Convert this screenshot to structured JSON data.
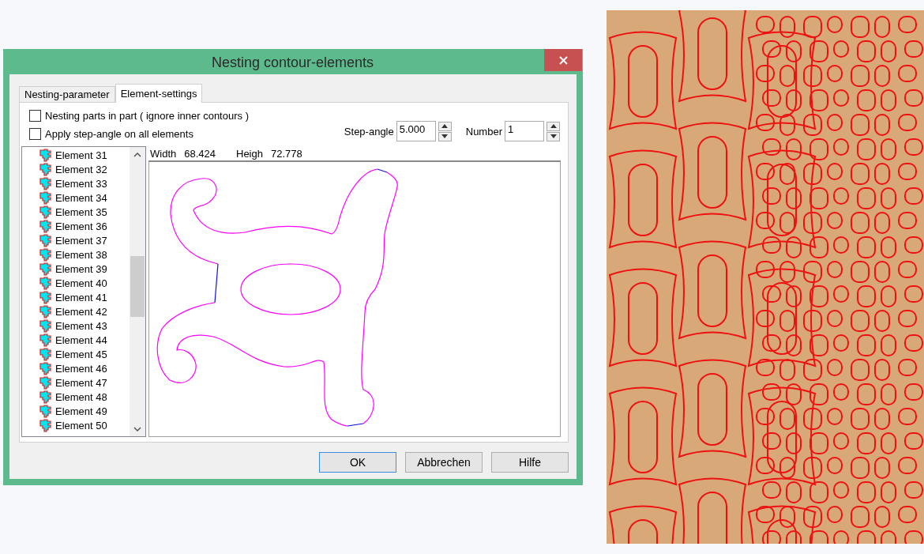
{
  "window": {
    "title": "Nesting contour-elements"
  },
  "tabs": [
    {
      "label": "Nesting-parameter",
      "selected": false
    },
    {
      "label": "Element-settings",
      "selected": true
    }
  ],
  "options": [
    {
      "label": "Nesting parts in part ( ignore inner contours )",
      "checked": false
    },
    {
      "label": "Apply step-angle on all elements",
      "checked": false
    }
  ],
  "spinners": [
    {
      "label": "Step-angle",
      "value": "5.000"
    },
    {
      "label": "Number",
      "value": "1"
    }
  ],
  "element_list": {
    "items": [
      {
        "label": "Element 31"
      },
      {
        "label": "Element 32"
      },
      {
        "label": "Element 33"
      },
      {
        "label": "Element 34"
      },
      {
        "label": "Element 35"
      },
      {
        "label": "Element 36"
      },
      {
        "label": "Element 37"
      },
      {
        "label": "Element 38"
      },
      {
        "label": "Element 39"
      },
      {
        "label": "Element 40"
      },
      {
        "label": "Element 41"
      },
      {
        "label": "Element 42"
      },
      {
        "label": "Element 43"
      },
      {
        "label": "Element 44"
      },
      {
        "label": "Element 45"
      },
      {
        "label": "Element 46"
      },
      {
        "label": "Element 47"
      },
      {
        "label": "Element 48"
      },
      {
        "label": "Element 49"
      },
      {
        "label": "Element 50"
      }
    ]
  },
  "preview": {
    "width_label": "Width",
    "width_value": "68.424",
    "height_label": "Heigh",
    "height_value": "72.778"
  },
  "buttons": [
    {
      "label": "OK",
      "focused": true
    },
    {
      "label": "Abbrechen",
      "focused": false
    },
    {
      "label": "Hilfe",
      "focused": false
    }
  ]
}
